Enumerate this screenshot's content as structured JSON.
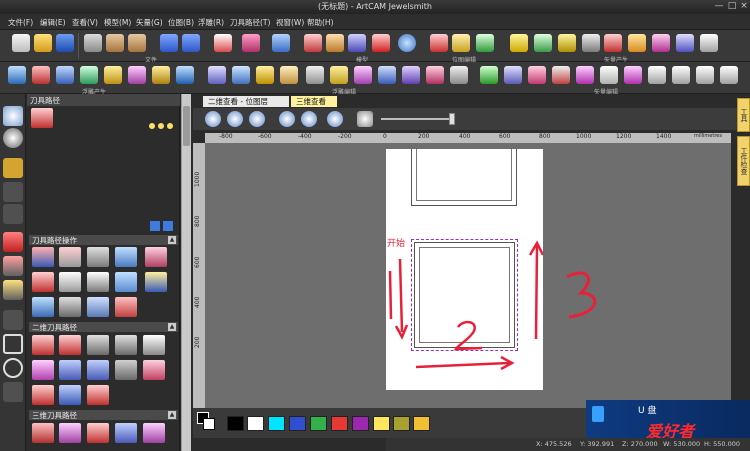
{
  "window": {
    "title": "(无标题) - ArtCAM Jewelsmith",
    "minimize": "—",
    "maximize": "□",
    "close": "×"
  },
  "menu": [
    "文件(F)",
    "编辑(E)",
    "查看(V)",
    "模型(M)",
    "矢量(G)",
    "位图(B)",
    "浮雕(R)",
    "刀具路径(T)",
    "视窗(W)",
    "帮助(H)"
  ],
  "toolbar_groups": {
    "file": "文件",
    "model": "模型",
    "bitmap": "位图编辑",
    "vector_create": "矢量产生",
    "relief_create": "浮雕产生",
    "relief_edit": "浮雕编辑",
    "vector_edit": "矢量编辑"
  },
  "panel": {
    "title": "刀具路径",
    "section_ops": "刀具路径操作",
    "section_2d": "二维刀具路径",
    "section_3d": "三维刀具路径",
    "collapse_glyph": "▲"
  },
  "tabs": {
    "tab1": "二维查看 - 位图层",
    "tab2": "三维查看"
  },
  "ruler": {
    "x_ticks": [
      "-800",
      "-600",
      "-400",
      "-200",
      "0",
      "200",
      "400",
      "600",
      "800",
      "1000",
      "1200",
      "1400"
    ],
    "unit": "millimetres",
    "y_ticks": [
      "1000",
      "800",
      "600",
      "400",
      "200"
    ]
  },
  "drawing": {
    "annotation_start": "开始",
    "label_1": "1",
    "label_2": "2",
    "label_3": "3"
  },
  "palette": {
    "colors": [
      "#000000",
      "#ffffff",
      "#00e5ff",
      "#2f4fd0",
      "#33b04a",
      "#e53935",
      "#9c27b0",
      "#ffe65c",
      "#a8a031",
      "#f0c030"
    ]
  },
  "status": {
    "x": "X: 475.526",
    "y": "Y: 392.991",
    "z": "Z: 270.000",
    "w": "W: 530.000",
    "h": "H: 550.000"
  },
  "right_tabs": {
    "tab1": "工具",
    "tab2": "工件检查"
  },
  "watermark": {
    "usb": "U 盘",
    "text": "爱好者"
  }
}
